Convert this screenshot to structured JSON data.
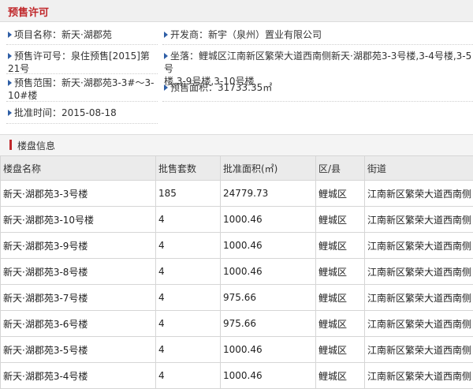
{
  "title": "预售许可",
  "info": {
    "project_name": "项目名称：新天·湖郡苑",
    "developer": "开发商：新宇（泉州）置业有限公司",
    "permit_no_line1": "预售许可号：泉住预售[2015]第",
    "permit_no_line2": "21号",
    "location_line1": "坐落：鲤城区江南新区繁荣大道西南侧新天·湖郡苑3-3号楼,3-4号楼,3-5号",
    "location_line2": "楼,3-9号楼,3-10号楼",
    "scope_line1": "预售范围：新天·湖郡苑3-3#～3-",
    "scope_line2": "10#楼",
    "area": "预售面积：31733.35㎡",
    "approval_date": "批准时间：2015-08-18"
  },
  "section_title": "楼盘信息",
  "table": {
    "headers": [
      "楼盘名称",
      "批售套数",
      "批准面积(㎡)",
      "区/县",
      "街道"
    ],
    "rows": [
      [
        "新天·湖郡苑3-3号楼",
        "185",
        "24779.73",
        "鲤城区",
        "江南新区繁荣大道西南侧"
      ],
      [
        "新天·湖郡苑3-10号楼",
        "4",
        "1000.46",
        "鲤城区",
        "江南新区繁荣大道西南侧"
      ],
      [
        "新天·湖郡苑3-9号楼",
        "4",
        "1000.46",
        "鲤城区",
        "江南新区繁荣大道西南侧"
      ],
      [
        "新天·湖郡苑3-8号楼",
        "4",
        "1000.46",
        "鲤城区",
        "江南新区繁荣大道西南侧"
      ],
      [
        "新天·湖郡苑3-7号楼",
        "4",
        "975.66",
        "鲤城区",
        "江南新区繁荣大道西南侧"
      ],
      [
        "新天·湖郡苑3-6号楼",
        "4",
        "975.66",
        "鲤城区",
        "江南新区繁荣大道西南侧"
      ],
      [
        "新天·湖郡苑3-5号楼",
        "4",
        "1000.46",
        "鲤城区",
        "江南新区繁荣大道西南侧"
      ],
      [
        "新天·湖郡苑3-4号楼",
        "4",
        "1000.46",
        "鲤城区",
        "江南新区繁荣大道西南侧"
      ]
    ]
  },
  "colors": {
    "title": "#c0282b",
    "arrow": "#2f5fa6",
    "header_bg": "#ebebeb",
    "border": "#d6d6d6"
  },
  "icons": {
    "bullet": "arrow-bullet-icon",
    "section": "red-bar-icon"
  }
}
